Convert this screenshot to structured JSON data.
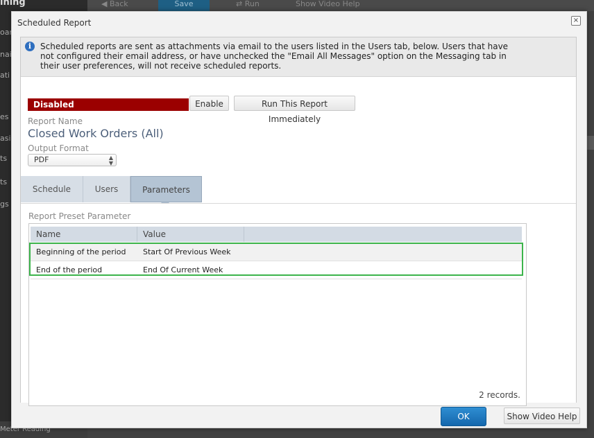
{
  "background_app": {
    "brand": "ining",
    "nav_fragments": [
      "oar",
      "nai",
      "ati",
      "es",
      "asir",
      "ts",
      "ts",
      "gs"
    ],
    "toolbar": {
      "back": "Back",
      "save": "Save",
      "run": "Run",
      "video_help": "Show Video Help"
    },
    "bottom_item": "Meter Reading"
  },
  "dialog": {
    "title": "Scheduled Report",
    "close_symbol": "×",
    "info_icon": "i",
    "info_text": "Scheduled reports are sent as attachments via email to the users listed in the Users tab, below. Users that have not configured their email address, or have unchecked the \"Email All Messages\" option on the Messaging tab in their user preferences, will not receive scheduled reports.",
    "status": {
      "label": "Disabled",
      "color": "#9b0000"
    },
    "enable_button": "Enable",
    "run_now_button": "Run This Report Immediately",
    "report_name_label": "Report Name",
    "report_name": "Closed Work Orders (All)",
    "output_format_label": "Output Format",
    "output_format_value": "PDF",
    "tabs": [
      {
        "label": "Schedule",
        "active": false
      },
      {
        "label": "Users",
        "active": false
      },
      {
        "label": "Parameters",
        "active": true
      }
    ],
    "parameters": {
      "section_label": "Report Preset Parameter",
      "columns": [
        "Name",
        "Value"
      ],
      "rows": [
        {
          "name": "Beginning of the period",
          "value": "Start Of Previous Week"
        },
        {
          "name": "End of the period",
          "value": "End Of Current Week"
        }
      ],
      "records_text": "2 records."
    },
    "ok_button": "OK",
    "video_help_button": "Show Video Help",
    "highlight_color": "#3cb44b"
  }
}
